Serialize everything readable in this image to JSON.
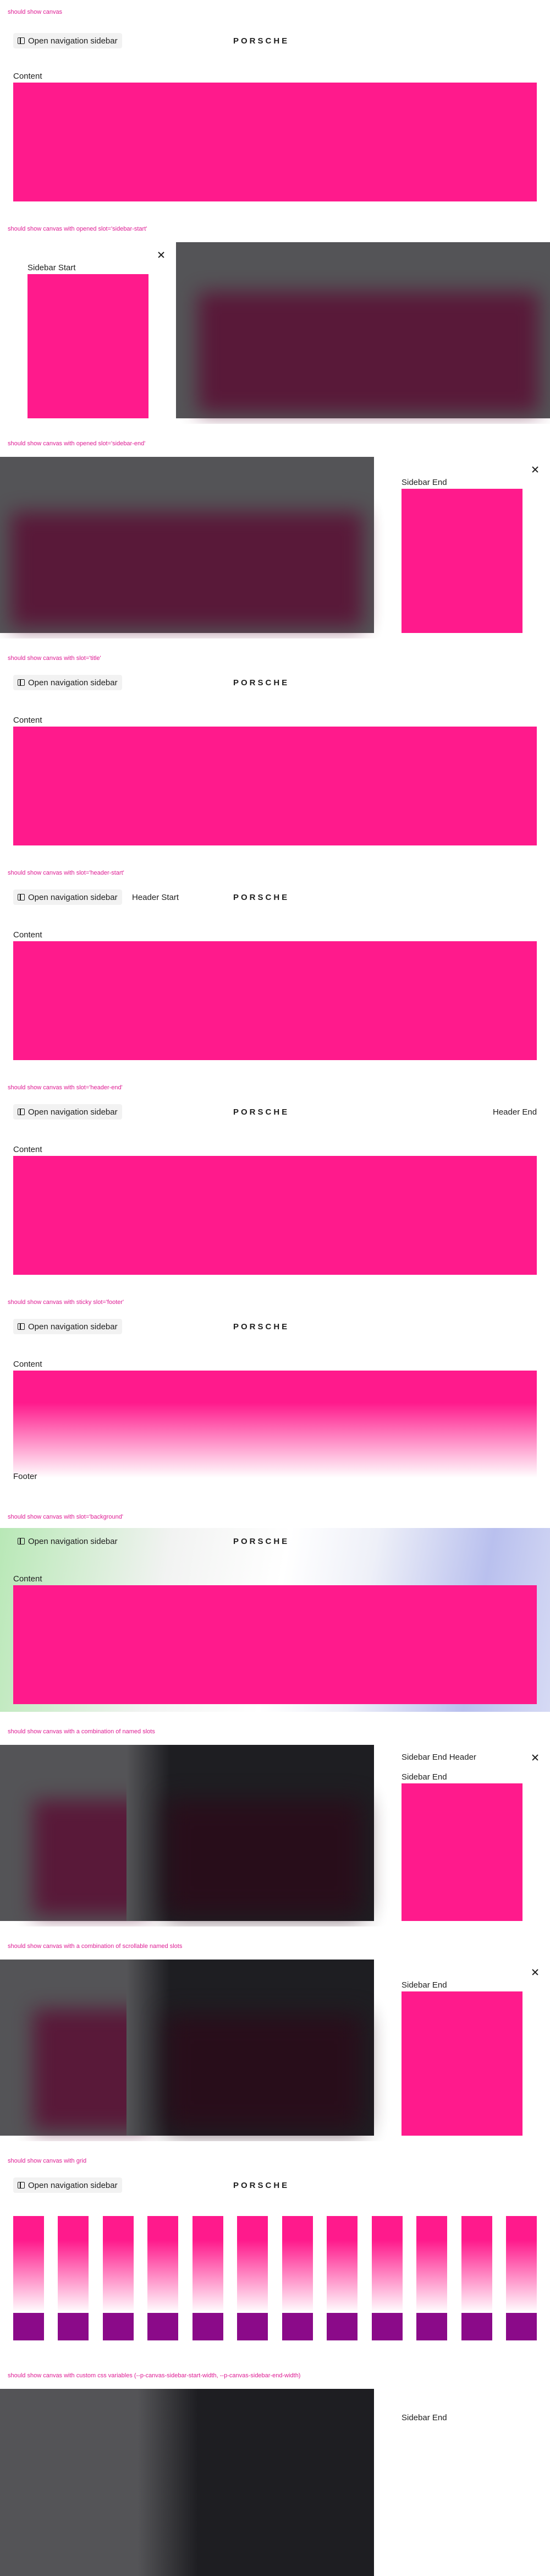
{
  "common": {
    "nav_button_label": "Open navigation sidebar",
    "logo_text": "PORSCHE",
    "content_label": "Content",
    "close_icon": "close-icon",
    "sidebar_icon": "sidebar-icon"
  },
  "sections": {
    "s1": {
      "title": "should show canvas"
    },
    "s2": {
      "title": "should show canvas with opened slot='sidebar-start'",
      "sidebar_label": "Sidebar Start"
    },
    "s3": {
      "title": "should show canvas with opened slot='sidebar-end'",
      "sidebar_label": "Sidebar End"
    },
    "s4": {
      "title": "should show canvas with slot='title'"
    },
    "s5": {
      "title": "should show canvas with slot='header-start'",
      "header_start": "Header Start"
    },
    "s6": {
      "title": "should show canvas with slot='header-end'",
      "header_end": "Header End"
    },
    "s7": {
      "title": "should show canvas with sticky slot='footer'",
      "footer_label": "Footer"
    },
    "s8": {
      "title": "should show canvas with slot='background'"
    },
    "s9": {
      "title": "should show canvas with a combination of named slots",
      "sidebar_end_header": "Sidebar End Header",
      "sidebar_end": "Sidebar End"
    },
    "s10": {
      "title": "should show canvas with a combination of scrollable named slots",
      "sidebar_end": "Sidebar End"
    },
    "s11": {
      "title": "should show canvas with grid",
      "columns": 12
    },
    "s12": {
      "title": "should show canvas with custom css variables (--p-canvas-sidebar-start-width, --p-canvas-sidebar-end-width)",
      "sidebar_end": "Sidebar End"
    }
  },
  "colors": {
    "accent": "#ff1a8c",
    "title": "#de1b93",
    "grid_purple": "#8b0a89",
    "overlay_dark": "#1e1e22",
    "overlay_grey": "#545457"
  }
}
